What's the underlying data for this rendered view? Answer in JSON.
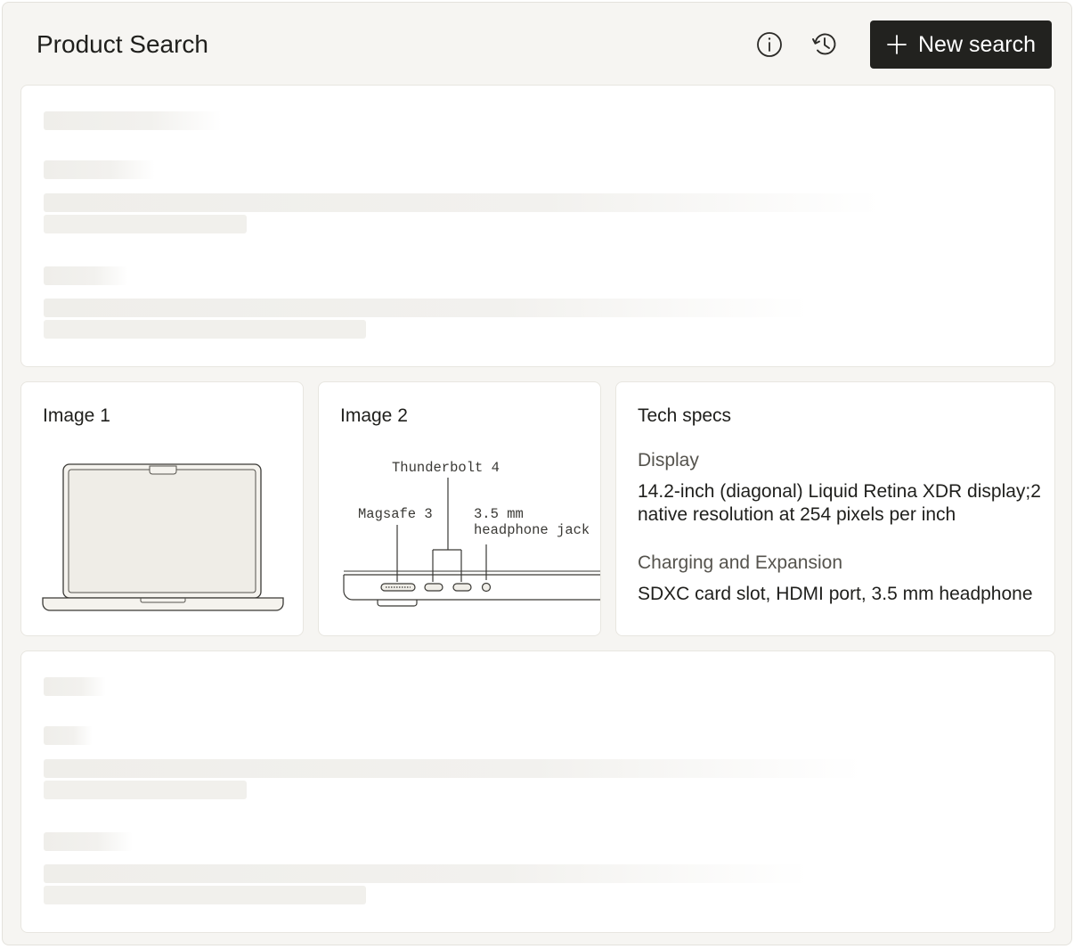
{
  "header": {
    "title": "Product Search",
    "info_icon": "info-icon",
    "history_icon": "history-icon",
    "new_search_label": "New search",
    "new_search_icon": "plus-icon"
  },
  "cards": {
    "image1": {
      "title": "Image 1",
      "illustration": "laptop-front-illustration"
    },
    "image2": {
      "title": "Image 2",
      "illustration": "laptop-side-ports-illustration",
      "labels": {
        "thunderbolt": "Thunderbolt 4",
        "magsafe": "Magsafe 3",
        "headphone_line1": "3.5 mm",
        "headphone_line2": "headphone jack"
      }
    },
    "tech_specs": {
      "title": "Tech specs",
      "specs": [
        {
          "label": "Display",
          "value_line1": "14.2-inch (diagonal) Liquid Retina XDR display;2",
          "value_line2": "native resolution at 254 pixels per inch"
        },
        {
          "label": "Charging and Expansion",
          "value_line1": "SDXC card slot, HDMI port,  3.5 mm headphone"
        }
      ]
    }
  },
  "colors": {
    "background": "#f6f5f2",
    "card": "#ffffff",
    "primary_button": "#22221f",
    "skeleton": "#efeeea"
  }
}
